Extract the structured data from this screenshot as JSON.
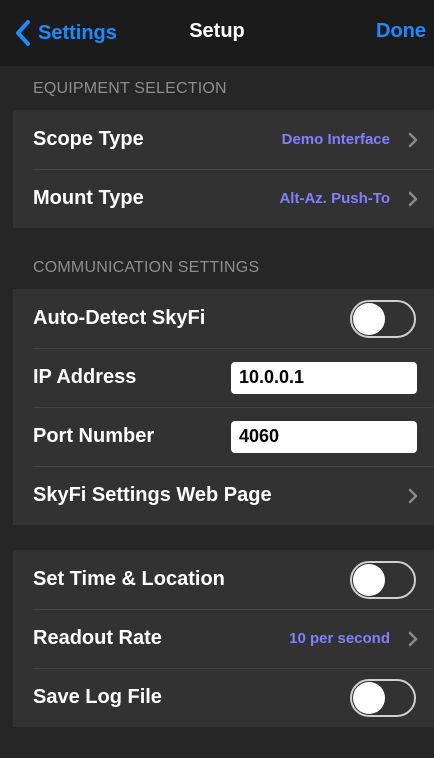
{
  "nav": {
    "back_label": "Settings",
    "title": "Setup",
    "done_label": "Done"
  },
  "equipment": {
    "header": "EQUIPMENT SELECTION",
    "scope_type": {
      "label": "Scope Type",
      "value": "Demo Interface"
    },
    "mount_type": {
      "label": "Mount Type",
      "value": "Alt-Az. Push-To"
    }
  },
  "communication": {
    "header": "COMMUNICATION SETTINGS",
    "auto_detect": {
      "label": "Auto-Detect SkyFi",
      "on": false
    },
    "ip_address": {
      "label": "IP Address",
      "value": "10.0.0.1"
    },
    "port_number": {
      "label": "Port Number",
      "value": "4060"
    },
    "web_page": {
      "label": "SkyFi Settings Web Page"
    }
  },
  "misc": {
    "set_time": {
      "label": "Set Time & Location",
      "on": false
    },
    "readout_rate": {
      "label": "Readout Rate",
      "value": "10 per second"
    },
    "save_log": {
      "label": "Save Log File",
      "on": false
    }
  },
  "colors": {
    "accent": "#1d8bff",
    "value": "#8080ff",
    "background": "#262626",
    "cell": "#323232"
  },
  "icons": {
    "back": "chevron-left-icon",
    "disclosure": "chevron-right-icon"
  }
}
